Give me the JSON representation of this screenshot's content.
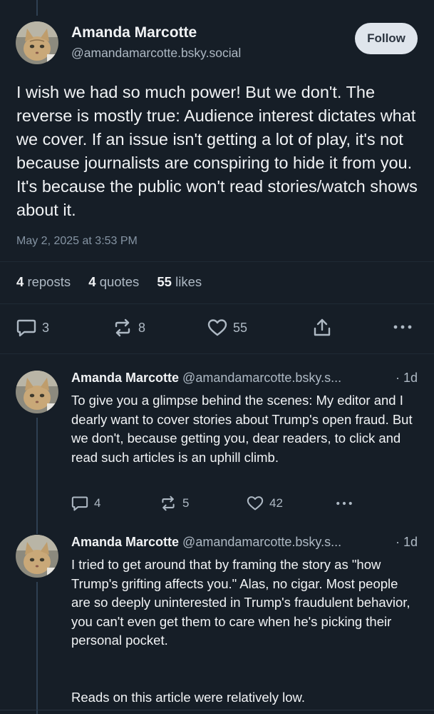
{
  "main_post": {
    "author_name": "Amanda Marcotte",
    "handle": "@amandamarcotte.bsky.social",
    "follow_label": "Follow",
    "text": "I wish we had so much power! But we don't. The reverse is mostly true: Audience interest dictates what we cover. If an issue isn't getting a lot of play, it's not because journalists are conspiring to hide it from you. It's because the public won't read stories/watch shows about it.",
    "timestamp": "May 2, 2025 at 3:53 PM",
    "stats": {
      "reposts_count": "4",
      "reposts_label": "reposts",
      "quotes_count": "4",
      "quotes_label": "quotes",
      "likes_count": "55",
      "likes_label": "likes"
    },
    "actions": {
      "replies": "3",
      "reposts": "8",
      "likes": "55"
    }
  },
  "replies": [
    {
      "author_name": "Amanda Marcotte",
      "handle": "@amandamarcotte.bsky.s...",
      "time": "· 1d",
      "text": "To give you a glimpse behind the scenes: My editor and I dearly want to cover stories about Trump's open fraud. But we don't, because getting you, dear readers, to click and read such articles is an uphill climb.",
      "actions": {
        "replies": "4",
        "reposts": "5",
        "likes": "42"
      }
    },
    {
      "author_name": "Amanda Marcotte",
      "handle": "@amandamarcotte.bsky.s...",
      "time": "· 1d",
      "text": "I tried to get around that by framing the story as \"how Trump's grifting affects you.\" Alas, no cigar. Most people are so deeply uninterested in Trump's fraudulent behavior, you can't even get them to care when he's picking their personal pocket.",
      "text2": "Reads on this article were relatively low."
    }
  ],
  "icons": {
    "reply": "speech-bubble-icon",
    "repost": "repost-arrows-icon",
    "like": "heart-icon",
    "share": "share-upload-icon",
    "more": "more-dots-icon"
  },
  "colors": {
    "background": "#161e27",
    "text_primary": "#f1f3f5",
    "text_secondary": "#aeb9c4",
    "follow_button_bg": "#dfe5ec",
    "thread_line": "#2e4052"
  }
}
